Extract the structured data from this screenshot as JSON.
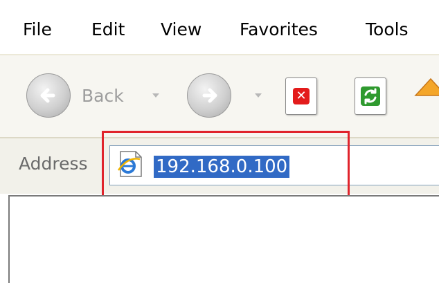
{
  "menu": {
    "items": [
      "File",
      "Edit",
      "View",
      "Favorites",
      "Tools"
    ]
  },
  "toolbar": {
    "back_label": "Back",
    "icons": [
      "back-arrow-icon",
      "dropdown-arrow-icon",
      "forward-arrow-icon",
      "stop-icon",
      "refresh-icon",
      "home-icon"
    ]
  },
  "address": {
    "label": "Address",
    "value": "192.168.0.100",
    "icon": "ie-page-icon"
  },
  "colors": {
    "highlight": "#e0242c",
    "selection": "#316ac5"
  }
}
